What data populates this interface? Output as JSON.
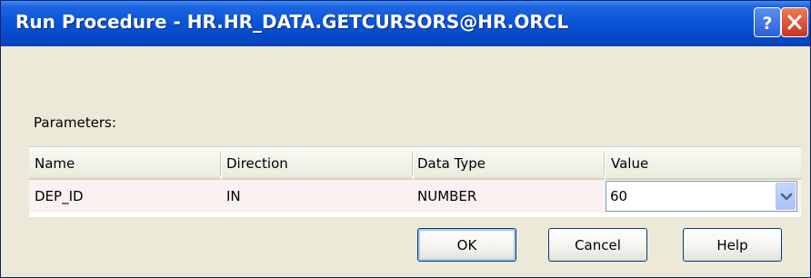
{
  "window": {
    "title": "Run Procedure - HR.HR_DATA.GETCURSORS@HR.ORCL"
  },
  "titlebar_icons": {
    "help": "question-mark-icon",
    "close": "close-x-icon",
    "help_color": "#2a5fd6",
    "close_color": "#c8361f"
  },
  "parameters": {
    "label": "Parameters:",
    "columns": [
      "Name",
      "Direction",
      "Data Type",
      "Value"
    ],
    "rows": [
      {
        "name": "DEP_ID",
        "direction": "IN",
        "data_type": "NUMBER",
        "value": "60"
      }
    ]
  },
  "buttons": {
    "ok": "OK",
    "cancel": "Cancel",
    "help": "Help"
  },
  "colors": {
    "titlebar": "#0548c7",
    "dialog_bg": "#ece9d8",
    "row_bg": "#fbf1f1"
  }
}
